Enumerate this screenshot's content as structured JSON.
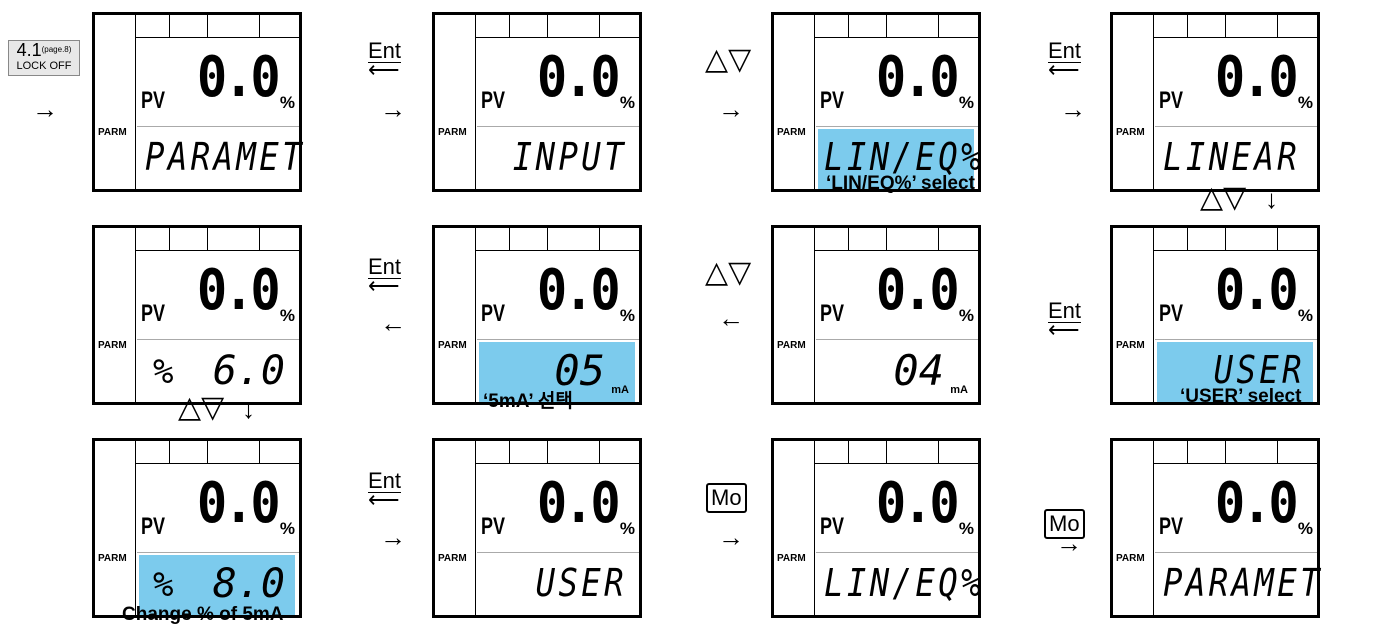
{
  "reference": {
    "number": "4.1",
    "page": "(page.8)",
    "label": "LOCK OFF"
  },
  "lcd_common": {
    "pv": "PV",
    "value": "0.0",
    "percent": "%",
    "parm": "PARM"
  },
  "screens": [
    {
      "line": "PARAMET",
      "highlight": false
    },
    {
      "line": "INPUT",
      "highlight": false
    },
    {
      "line": "LIN/EQ%",
      "highlight": true
    },
    {
      "line": "LINEAR",
      "highlight": false
    },
    {
      "line": "USER",
      "highlight": true
    },
    {
      "num": "04",
      "unit": "mA",
      "highlight": false
    },
    {
      "num": "05",
      "unit": "mA",
      "highlight": true
    },
    {
      "pct": "%",
      "val": "6.0",
      "highlight": false
    },
    {
      "pct": "%",
      "val": "8.0",
      "highlight": true
    },
    {
      "line": "USER",
      "highlight": false
    },
    {
      "line": "LIN/EQ%",
      "highlight": false
    },
    {
      "line": "PARAMET",
      "highlight": false
    }
  ],
  "keys": {
    "ent": "Ent",
    "updown": "△▽",
    "mo": "Mo",
    "right_arrow": "→",
    "left_arrow": "←",
    "down_arrow": "↓"
  },
  "captions": {
    "lin_eq": "‘LIN/EQ%’ select",
    "user": "‘USER’ select",
    "five_ma": "‘5mA’ 선택",
    "change": "Change % of 5mA"
  }
}
